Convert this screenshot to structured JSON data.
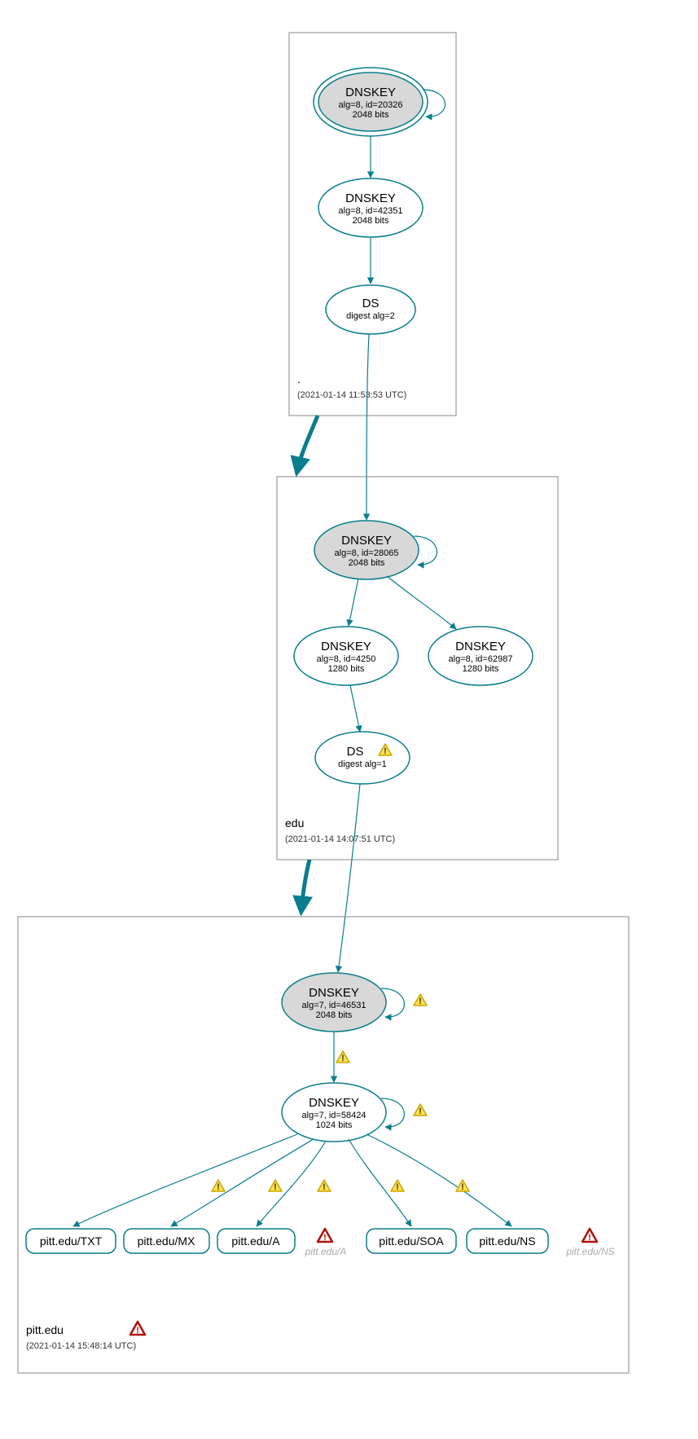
{
  "zones": {
    "root": {
      "label": ".",
      "date": "(2021-01-14 11:53:53 UTC)"
    },
    "edu": {
      "label": "edu",
      "date": "(2021-01-14 14:07:51 UTC)"
    },
    "pitt": {
      "label": "pitt.edu",
      "date": "(2021-01-14 15:48:14 UTC)"
    }
  },
  "nodes": {
    "root_ksk": {
      "title": "DNSKEY",
      "line2": "alg=8, id=20326",
      "line3": "2048 bits"
    },
    "root_zsk": {
      "title": "DNSKEY",
      "line2": "alg=8, id=42351",
      "line3": "2048 bits"
    },
    "root_ds": {
      "title": "DS",
      "line2": "digest alg=2"
    },
    "edu_ksk": {
      "title": "DNSKEY",
      "line2": "alg=8, id=28065",
      "line3": "2048 bits"
    },
    "edu_zsk1": {
      "title": "DNSKEY",
      "line2": "alg=8, id=4250",
      "line3": "1280 bits"
    },
    "edu_zsk2": {
      "title": "DNSKEY",
      "line2": "alg=8, id=62987",
      "line3": "1280 bits"
    },
    "edu_ds": {
      "title": "DS",
      "line2": "digest alg=1"
    },
    "pitt_ksk": {
      "title": "DNSKEY",
      "line2": "alg=7, id=46531",
      "line3": "2048 bits"
    },
    "pitt_zsk": {
      "title": "DNSKEY",
      "line2": "alg=7, id=58424",
      "line3": "1024 bits"
    }
  },
  "records": {
    "txt": "pitt.edu/TXT",
    "mx": "pitt.edu/MX",
    "a": "pitt.edu/A",
    "soa": "pitt.edu/SOA",
    "ns": "pitt.edu/NS"
  },
  "ghosts": {
    "a": "pitt.edu/A",
    "ns": "pitt.edu/NS"
  }
}
